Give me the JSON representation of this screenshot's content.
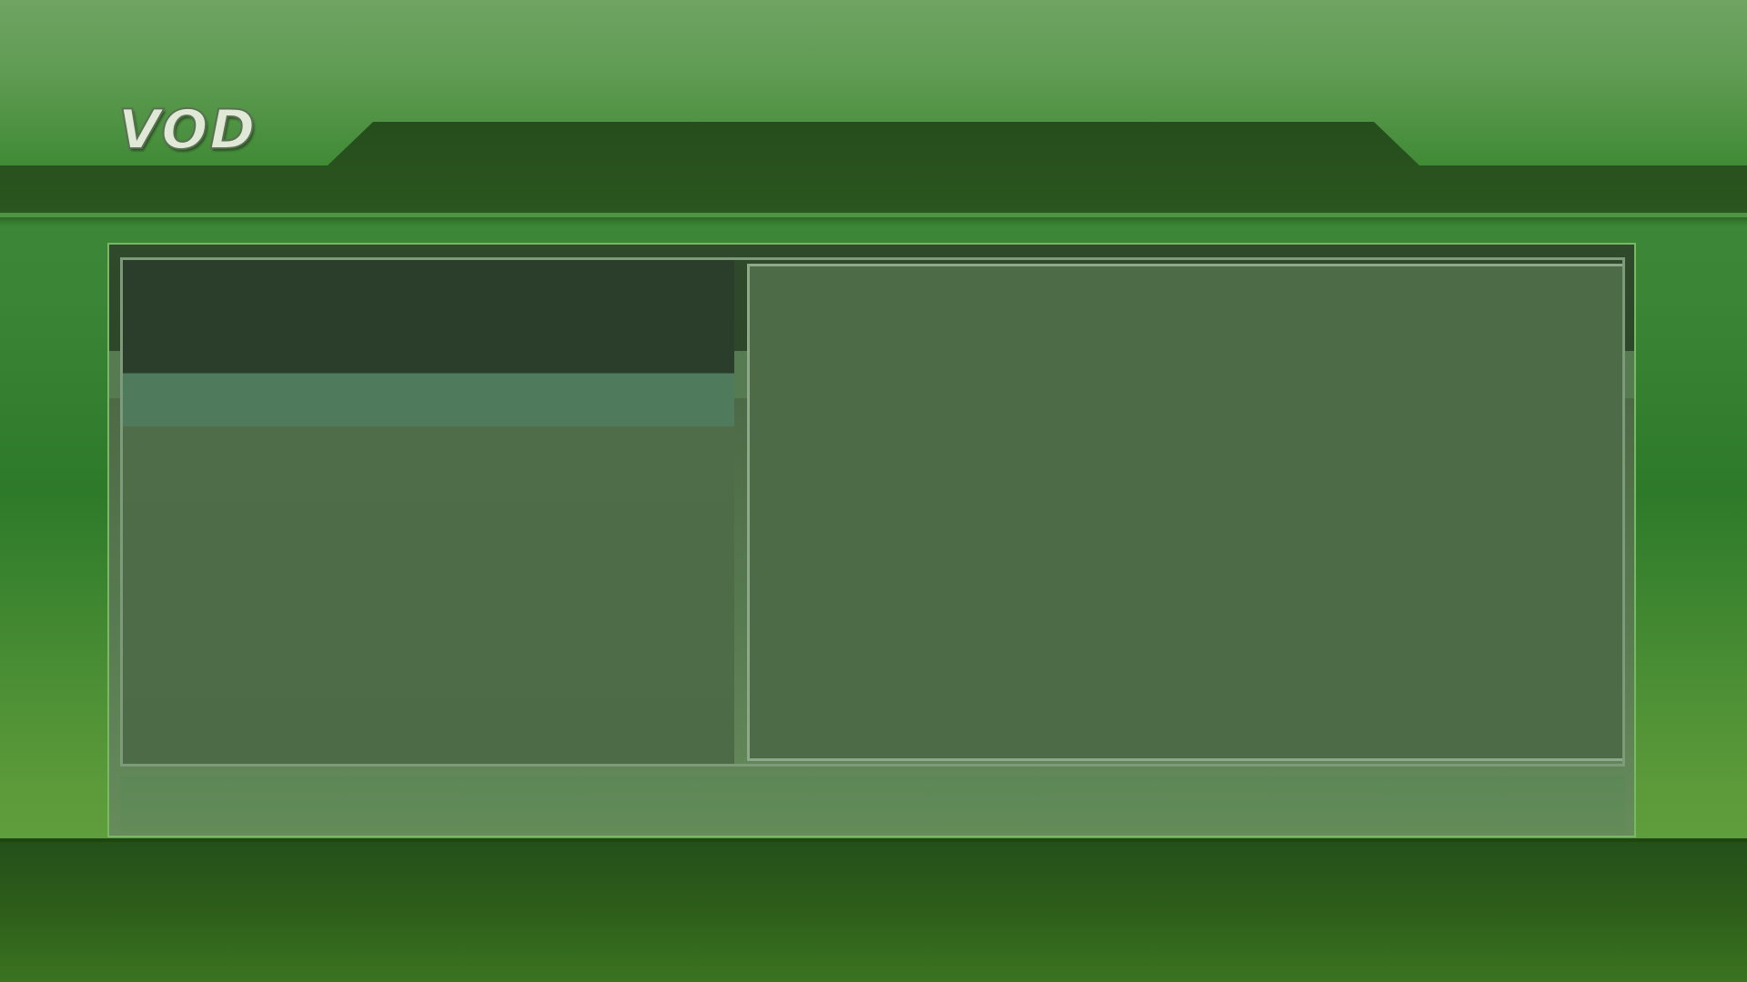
{
  "header": {
    "logo_text": "VOD"
  },
  "colors": {
    "background_green": "#3b8636",
    "header_tab": "#264d1d",
    "panel_dark": "#2b3d2b",
    "panel_highlight": "#4f7a5c",
    "panel_body": "#4e6b48",
    "frame_border": "#7ab963",
    "bottom_band": "#24501a"
  }
}
